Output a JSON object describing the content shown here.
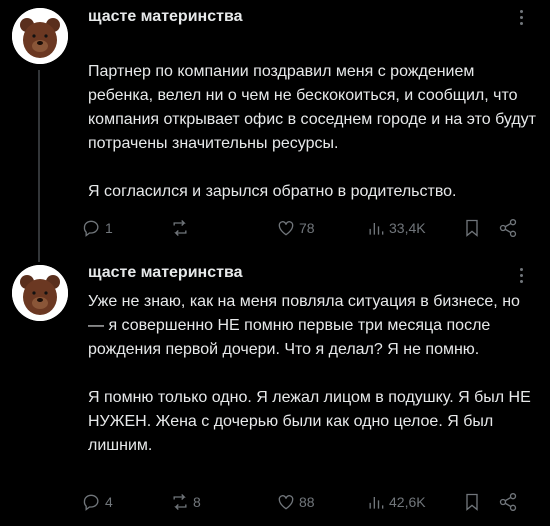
{
  "posts": [
    {
      "author": "щасте материнства",
      "paragraphs": [
        "Партнер по компании поздравил меня с рождением ребенка, велел ни о чем не бескокоиться, и сообщил, что компания открывает офис в соседнем городе и на это будут потрачены значительны ресурсы.",
        "Я согласился и зарылся обратно в родительство."
      ],
      "stats": {
        "replies": "1",
        "reposts": "",
        "likes": "78",
        "views": "33,4K"
      }
    },
    {
      "author": "щасте материнства",
      "paragraphs": [
        "Уже не знаю, как на меня повляла ситуация в бизнесе, но — я совершенно НЕ помню первые три месяца после рождения первой дочери. Что я делал? Я не помню.",
        "Я помню только одно. Я лежал лицом в подушку. Я был НЕ НУЖЕН. Жена с дочерью были как одно целое. Я был лишним."
      ],
      "stats": {
        "replies": "4",
        "reposts": "8",
        "likes": "88",
        "views": "42,6K"
      }
    }
  ],
  "icons": {
    "avatar": "bear-avatar",
    "more": "more-dots-icon",
    "reply": "reply-bubble-icon",
    "repost": "repost-arrows-icon",
    "like": "heart-icon",
    "views": "views-bars-icon",
    "bookmark": "bookmark-icon",
    "share": "share-icon"
  },
  "colors": {
    "background": "#000000",
    "text": "#e7e9ea",
    "muted": "#71767b"
  }
}
